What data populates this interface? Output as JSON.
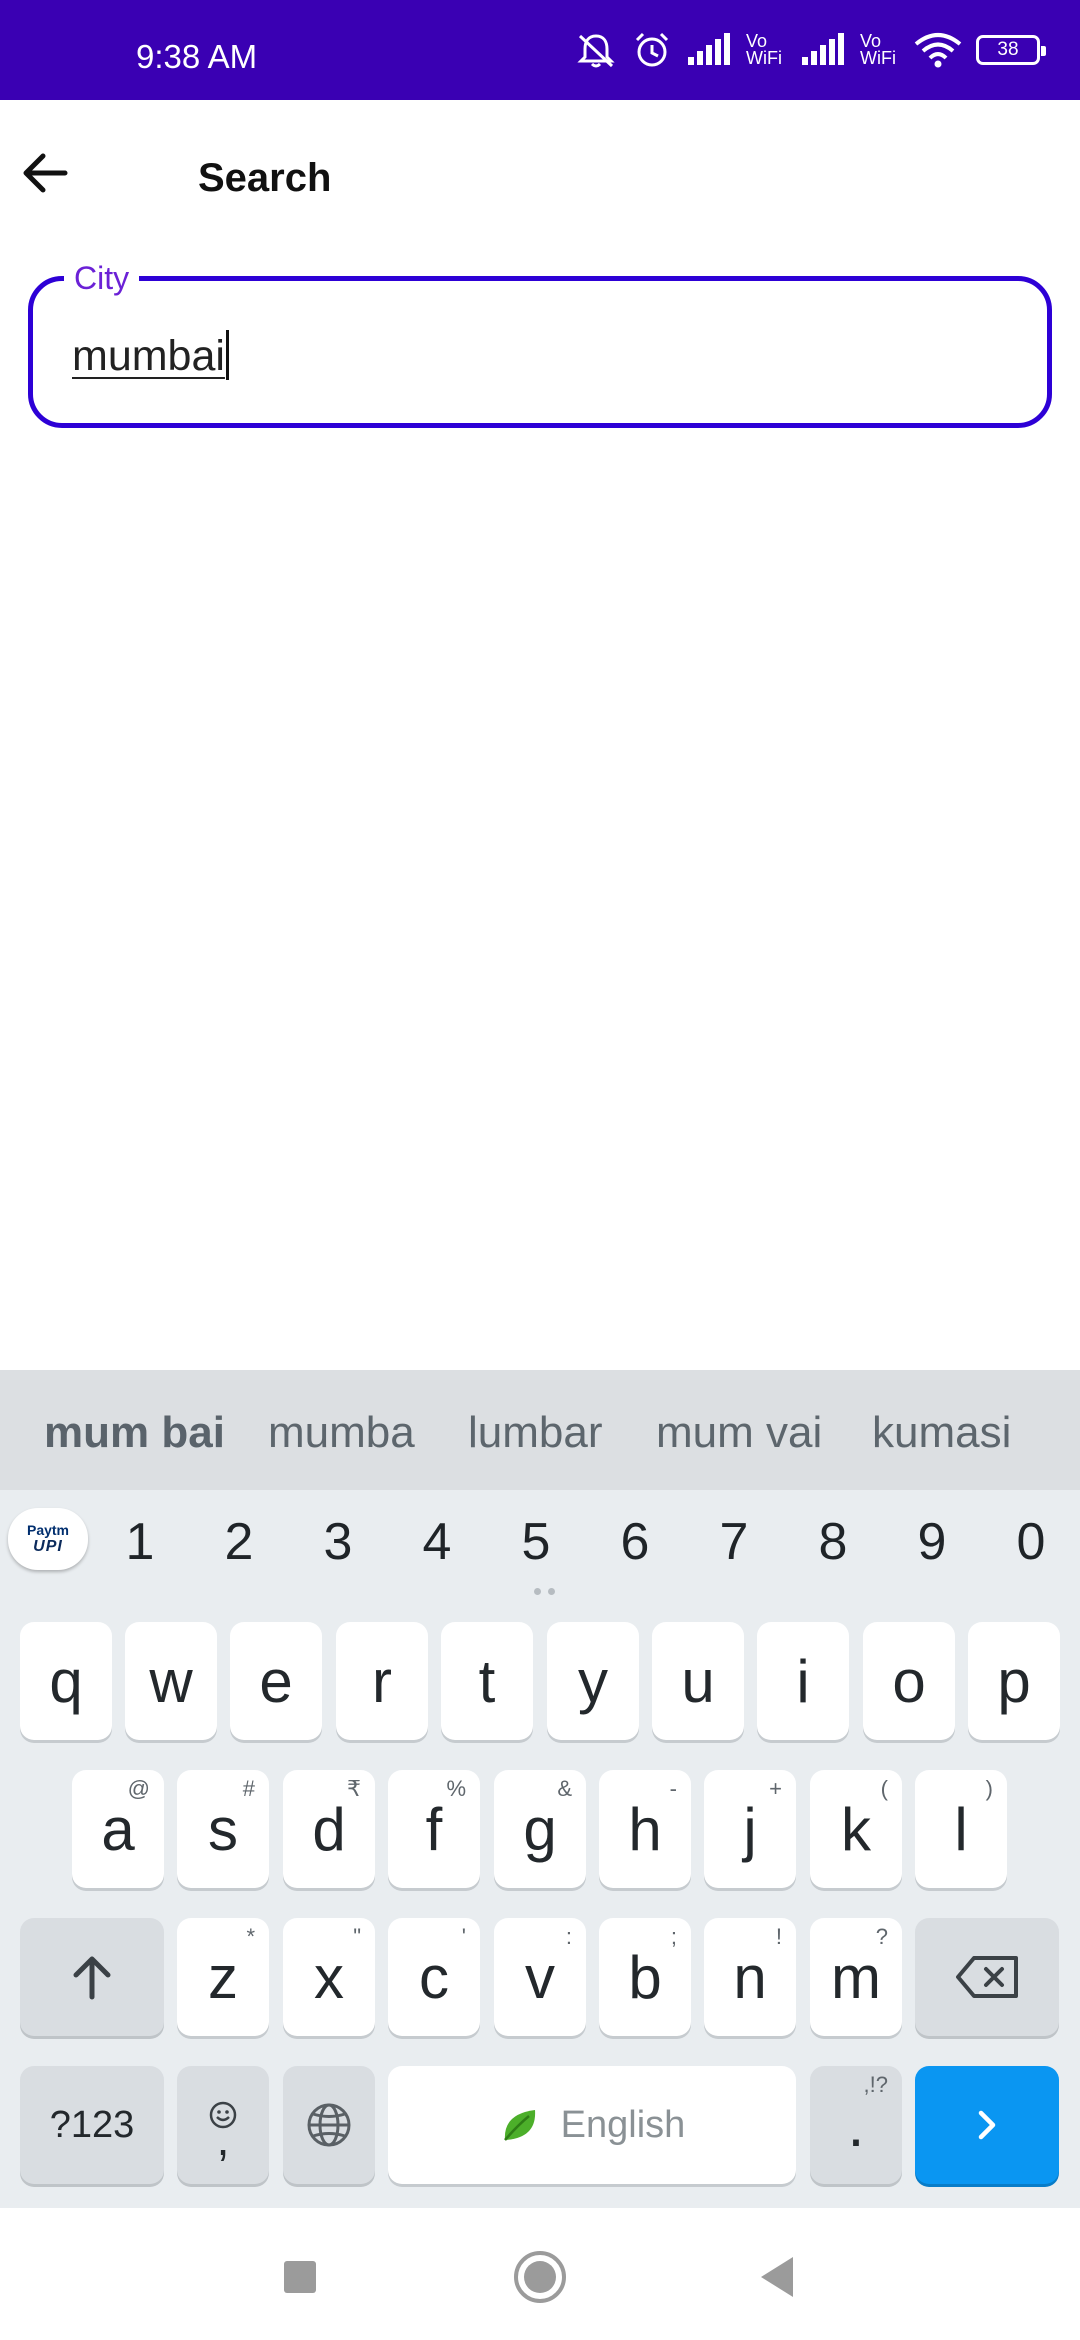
{
  "status_bar": {
    "time": "9:38 AM",
    "vowifi_1": "Vo WiFi",
    "vowifi_2": "Vo WiFi",
    "battery": "38",
    "icons": [
      "mute-icon",
      "alarm-icon",
      "signal-icon",
      "wifi-icon",
      "battery-icon"
    ],
    "bg_color": "#3a00b3"
  },
  "app_bar": {
    "title": "Search",
    "back_icon": "arrow-left-icon"
  },
  "search_form": {
    "city_label": "City",
    "city_value": "mumbai",
    "accent_color": "#2d00d6"
  },
  "keyboard": {
    "suggestions": [
      "mum bai",
      "mumba",
      "lumbar",
      "mum vai",
      "kumasi"
    ],
    "paytm": {
      "top": "Paytm",
      "bottom": "UPI"
    },
    "numbers": [
      "1",
      "2",
      "3",
      "4",
      "5",
      "6",
      "7",
      "8",
      "9",
      "0"
    ],
    "row1": [
      "q",
      "w",
      "e",
      "r",
      "t",
      "y",
      "u",
      "i",
      "o",
      "p"
    ],
    "row2": [
      {
        "key": "a",
        "sup": "@"
      },
      {
        "key": "s",
        "sup": "#"
      },
      {
        "key": "d",
        "sup": "₹"
      },
      {
        "key": "f",
        "sup": "%"
      },
      {
        "key": "g",
        "sup": "&"
      },
      {
        "key": "h",
        "sup": "-"
      },
      {
        "key": "j",
        "sup": "+"
      },
      {
        "key": "k",
        "sup": "("
      },
      {
        "key": "l",
        "sup": ")"
      }
    ],
    "row3": [
      {
        "key": "z",
        "sup": "*"
      },
      {
        "key": "x",
        "sup": "\""
      },
      {
        "key": "c",
        "sup": "'"
      },
      {
        "key": "v",
        "sup": ":"
      },
      {
        "key": "b",
        "sup": ";"
      },
      {
        "key": "n",
        "sup": "!"
      },
      {
        "key": "m",
        "sup": "?"
      }
    ],
    "symbols_key": "?123",
    "comma_key": ",",
    "space_label": "English",
    "period_key": ".",
    "period_sup": ",!?",
    "go_color": "#0a96f2"
  },
  "nav_bar": {
    "buttons": [
      "recents-square-icon",
      "home-circle-icon",
      "back-triangle-icon"
    ]
  }
}
